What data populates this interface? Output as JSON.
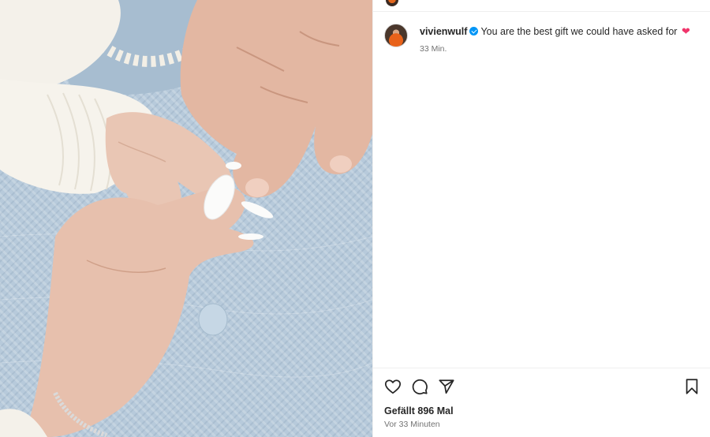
{
  "post": {
    "image_alt": "",
    "author": "vivienwulf",
    "verified": true,
    "caption": "You are the best gift we could have asked for",
    "caption_emoji": "❤",
    "time_short": "33 Min.",
    "likes_text": "Gefällt 896 Mal",
    "time_long": "Vor 33 Minuten"
  },
  "icons": {
    "like": "heart-icon",
    "comment": "comment-icon",
    "share": "send-icon",
    "save": "bookmark-icon",
    "verified": "verified-badge-icon"
  },
  "colors": {
    "verified_blue": "#0095f6",
    "emoji_heart": "#f0356b",
    "blanket_blue": "#b7cadb"
  }
}
